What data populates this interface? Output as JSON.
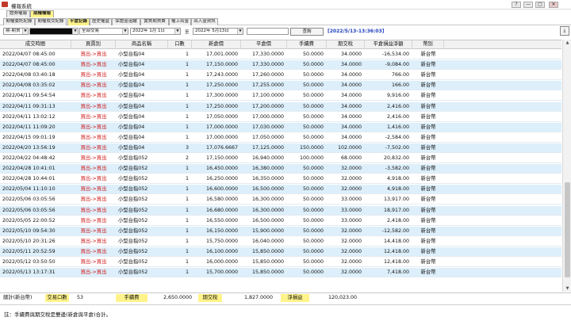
{
  "window": {
    "title": "權報系統",
    "min": "—",
    "max": "□",
    "close": "✕",
    "help": "?"
  },
  "tabs_row1": [
    {
      "label": "證券權報",
      "active": false
    },
    {
      "label": "期權權報",
      "active": true
    }
  ],
  "tabs_row2": [
    {
      "label": "期權委託紀錄",
      "active": false
    },
    {
      "label": "期權成交紀錄",
      "active": false
    },
    {
      "label": "平倉記錄",
      "active": true
    },
    {
      "label": "歷史權益",
      "active": false
    },
    {
      "label": "保證金追繳",
      "active": false
    },
    {
      "label": "實質期貨費",
      "active": false
    },
    {
      "label": "權上出金",
      "active": false
    },
    {
      "label": "出入金資訊",
      "active": false
    }
  ],
  "filters": {
    "account_type": "期-期貨",
    "account_value": "",
    "trade_type": "全部交易",
    "date_from": "2022年 1月 1日",
    "date_sep": "至",
    "date_to": "2022年 5月13日",
    "search_box": "",
    "query_label": "查詢",
    "timestamp": "[2022/5/13-13:36:03]"
  },
  "table": {
    "columns": [
      "成交時間",
      "買賣別",
      "商品名稱",
      "口數",
      "新倉價",
      "平倉價",
      "手續費",
      "期交稅",
      "平倉損益淨額",
      "幣別"
    ],
    "rows": [
      [
        "2022/04/07 08:45:00",
        "買出->買出",
        "小型台指04",
        "1",
        "17,001.0000",
        "17,330.0000",
        "50.0000",
        "34.0000",
        "-16,534.00",
        "新台幣"
      ],
      [
        "2022/04/07 08:45:00",
        "買出->買出",
        "小型台指04",
        "1",
        "17,150.0000",
        "17,330.0000",
        "50.0000",
        "34.0000",
        "-9,084.00",
        "新台幣"
      ],
      [
        "2022/04/08 03:40:18",
        "買出->買出",
        "小型台指04",
        "1",
        "17,243.0000",
        "17,260.0000",
        "50.0000",
        "34.0000",
        "766.00",
        "新台幣"
      ],
      [
        "2022/04/08 03:35:02",
        "買出->買出",
        "小型台指04",
        "1",
        "17,250.0000",
        "17,255.0000",
        "50.0000",
        "34.0000",
        "166.00",
        "新台幣"
      ],
      [
        "2022/04/11 09:54:54",
        "買出->買出",
        "小型台指04",
        "1",
        "17,300.0000",
        "17,100.0000",
        "50.0000",
        "34.0000",
        "9,916.00",
        "新台幣"
      ],
      [
        "2022/04/11 09:31:13",
        "買出->買出",
        "小型台指04",
        "1",
        "17,250.0000",
        "17,200.0000",
        "50.0000",
        "34.0000",
        "2,416.00",
        "新台幣"
      ],
      [
        "2022/04/11 13:02:12",
        "買出->買出",
        "小型台指04",
        "1",
        "17,050.0000",
        "17,000.0000",
        "50.0000",
        "34.0000",
        "2,416.00",
        "新台幣"
      ],
      [
        "2022/04/11 11:09:20",
        "買出->買出",
        "小型台指04",
        "1",
        "17,000.0000",
        "17,030.0000",
        "50.0000",
        "34.0000",
        "1,416.00",
        "新台幣"
      ],
      [
        "2022/04/15 09:01:19",
        "買出->買出",
        "小型台指04",
        "1",
        "17,000.0000",
        "17,050.0000",
        "50.0000",
        "34.0000",
        "-2,584.00",
        "新台幣"
      ],
      [
        "2022/04/20 13:56:19",
        "買出->買出",
        "小型台指04",
        "3",
        "17,076.6667",
        "17,125.0000",
        "150.0000",
        "102.0000",
        "-7,502.00",
        "新台幣"
      ],
      [
        "2022/04/22 04:48:42",
        "買出->買出",
        "小型台指052",
        "2",
        "17,150.0000",
        "16,940.0000",
        "100.0000",
        "68.0000",
        "20,832.00",
        "新台幣"
      ],
      [
        "2022/04/28 10:41:01",
        "買出->買出",
        "小型台指052",
        "1",
        "16,450.0000",
        "16,380.0000",
        "50.0000",
        "32.0000",
        "-3,582.00",
        "新台幣"
      ],
      [
        "2022/04/28 10:44:01",
        "買出->買出",
        "小型台指052",
        "1",
        "16,250.0000",
        "16,350.0000",
        "50.0000",
        "32.0000",
        "4,918.00",
        "新台幣"
      ],
      [
        "2022/05/04 11:10:10",
        "買出->買出",
        "小型台指052",
        "1",
        "16,600.0000",
        "16,500.0000",
        "50.0000",
        "32.0000",
        "4,918.00",
        "新台幣"
      ],
      [
        "2022/05/06 03:05:56",
        "買出->買出",
        "小型台指052",
        "1",
        "16,580.0000",
        "16,300.0000",
        "50.0000",
        "33.0000",
        "13,917.00",
        "新台幣"
      ],
      [
        "2022/05/06 03:05:56",
        "買出->買出",
        "小型台指052",
        "1",
        "16,680.0000",
        "16,300.0000",
        "50.0000",
        "33.0000",
        "18,917.00",
        "新台幣"
      ],
      [
        "2022/05/05 22:00:52",
        "買出->買出",
        "小型台指052",
        "1",
        "16,550.0000",
        "16,500.0000",
        "50.0000",
        "33.0000",
        "2,418.00",
        "新台幣"
      ],
      [
        "2022/05/10 09:54:30",
        "買出->買出",
        "小型台指052",
        "1",
        "16,150.0000",
        "15,900.0000",
        "50.0000",
        "32.0000",
        "-12,582.00",
        "新台幣"
      ],
      [
        "2022/05/10 20:31:26",
        "買出->買出",
        "小型台指052",
        "1",
        "15,750.0000",
        "16,040.0000",
        "50.0000",
        "32.0000",
        "14,418.00",
        "新台幣"
      ],
      [
        "2022/05/11 20:52:59",
        "買出->買出",
        "小型台指052",
        "1",
        "16,100.0000",
        "15,850.0000",
        "50.0000",
        "32.0000",
        "12,418.00",
        "新台幣"
      ],
      [
        "2022/05/12 03:50:50",
        "買出->買出",
        "小型台指052",
        "1",
        "16,000.0000",
        "15,850.0000",
        "50.0000",
        "32.0000",
        "12,418.00",
        "新台幣"
      ],
      [
        "2022/05/13 13:17:31",
        "買出->買出",
        "小型台指052",
        "1",
        "15,700.0000",
        "15,850.0000",
        "50.0000",
        "32.0000",
        "7,418.00",
        "新台幣"
      ]
    ]
  },
  "totals": {
    "label": "總計(新台幣)",
    "lots_label": "交易口數",
    "lots": "53",
    "fee_label": "手續費",
    "fee": "2,650.0000",
    "tax_label": "期交稅",
    "tax": "1,827.0000",
    "net_label": "淨損益",
    "net": "120,023.00"
  },
  "note": "註：手續費與期交稅是雙邊(新倉與平倉)合計。",
  "colors": {
    "highlight": "#fff38a",
    "row_alt": "#dceffb",
    "buysell": "#d01818",
    "timestamp": "#1f3fbf"
  }
}
